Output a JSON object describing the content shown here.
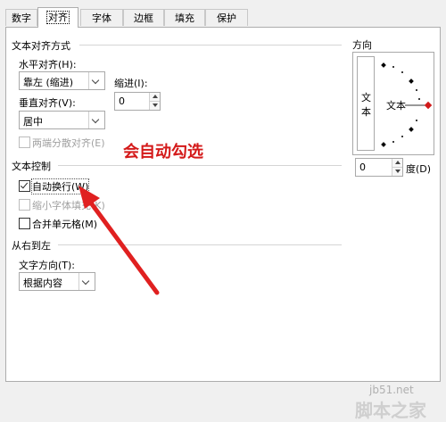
{
  "tabs": [
    {
      "label": "数字",
      "active": false
    },
    {
      "label": "对齐",
      "active": true
    },
    {
      "label": "字体",
      "active": false
    },
    {
      "label": "边框",
      "active": false
    },
    {
      "label": "填充",
      "active": false
    },
    {
      "label": "保护",
      "active": false
    }
  ],
  "text_alignment": {
    "group_title": "文本对齐方式",
    "horizontal_label": "水平对齐(H):",
    "horizontal_value": "靠左 (缩进)",
    "indent_label": "缩进(I):",
    "indent_value": "0",
    "vertical_label": "垂直对齐(V):",
    "vertical_value": "居中",
    "distributed_label": "两端分散对齐(E)"
  },
  "text_control": {
    "group_title": "文本控制",
    "wrap_text_label": "自动换行(W)",
    "wrap_text_checked": true,
    "shrink_label": "缩小字体填充(K)",
    "shrink_checked": false,
    "merge_label": "合并单元格(M)",
    "merge_checked": false
  },
  "rtl": {
    "group_title": "从右到左",
    "direction_label": "文字方向(T):",
    "direction_value": "根据内容"
  },
  "orientation": {
    "title": "方向",
    "vertical_text": [
      "文",
      "本"
    ],
    "dial_text": "文本",
    "degree_value": "0",
    "degree_label": "度(D)"
  },
  "annotation": {
    "text": "会自动勾选",
    "color": "#d41a1a"
  },
  "watermark": {
    "site": "jb51.net",
    "name": "脚本之家"
  }
}
